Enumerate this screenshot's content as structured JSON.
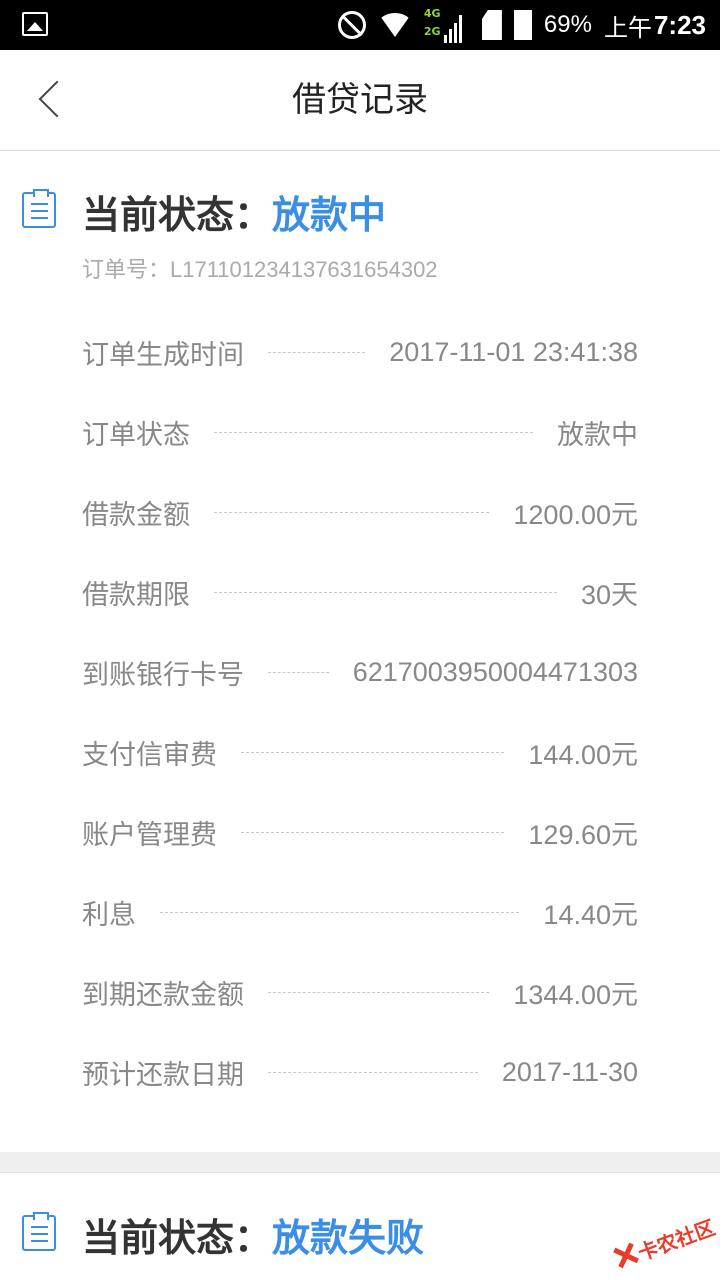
{
  "status_bar": {
    "battery": "69%",
    "ampm": "上午",
    "time": "7:23",
    "net_top": "4G",
    "net_bottom": "2G"
  },
  "header": {
    "title": "借贷记录"
  },
  "records": [
    {
      "status_label": "当前状态：",
      "status_value": "放款中",
      "order_no": "订单号：L171101234137631654302",
      "rows": [
        {
          "label": "订单生成时间",
          "value": "2017-11-01 23:41:38"
        },
        {
          "label": "订单状态",
          "value": "放款中"
        },
        {
          "label": "借款金额",
          "value": "1200.00元"
        },
        {
          "label": "借款期限",
          "value": "30天"
        },
        {
          "label": "到账银行卡号",
          "value": "6217003950004471303"
        },
        {
          "label": "支付信审费",
          "value": "144.00元"
        },
        {
          "label": "账户管理费",
          "value": "129.60元"
        },
        {
          "label": "利息",
          "value": "14.40元"
        },
        {
          "label": "到期还款金额",
          "value": "1344.00元"
        },
        {
          "label": "预计还款日期",
          "value": "2017-11-30"
        }
      ]
    },
    {
      "status_label": "当前状态：",
      "status_value": "放款失败"
    }
  ],
  "watermark": {
    "text": "卡农社区"
  },
  "colors": {
    "accent": "#3a8ee6",
    "watermark": "#e83c2a"
  }
}
